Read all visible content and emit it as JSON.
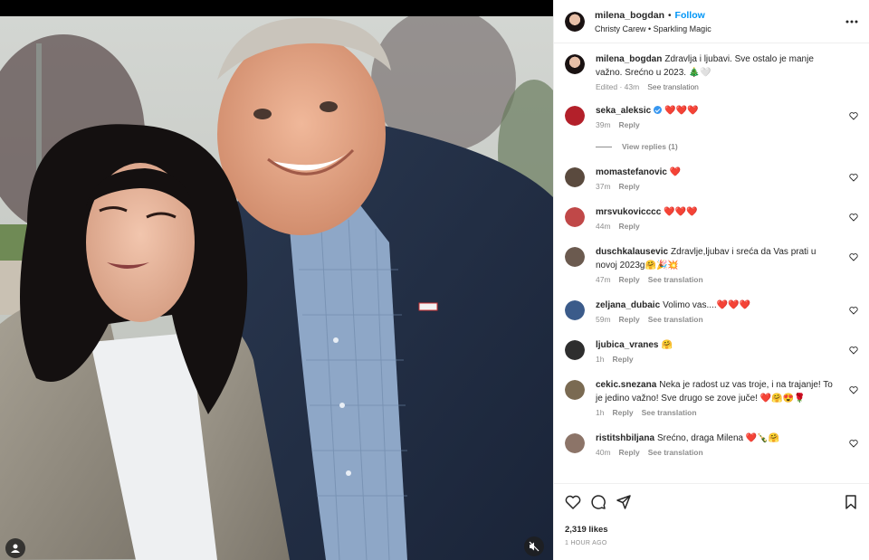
{
  "post": {
    "username": "milena_bogdan",
    "follow_label": "Follow",
    "audio": "Christy Carew • Sparkling Magic",
    "caption": {
      "username": "milena_bogdan",
      "text": "Zdravlja i ljubavi. Sve ostalo je manje važno. Srećno u 2023. 🎄🤍",
      "time": "Edited · 43m",
      "see_translation": "See translation"
    }
  },
  "comments": [
    {
      "username": "seka_aleksic",
      "verified": true,
      "text": "❤️❤️❤️",
      "time": "39m",
      "reply": "Reply",
      "view_replies": "View replies (1)",
      "avatar_color": "#b3202a"
    },
    {
      "username": "momastefanovic",
      "text": "❤️",
      "time": "37m",
      "reply": "Reply",
      "avatar_color": "#5a4a3e"
    },
    {
      "username": "mrsvukovicccc",
      "text": "❤️❤️❤️",
      "time": "44m",
      "reply": "Reply",
      "avatar_color": "#c04848"
    },
    {
      "username": "duschkalausevic",
      "text": "Zdravlje,ljubav i sreća da Vas prati u novoj 2023g🤗🎉💥",
      "time": "47m",
      "reply": "Reply",
      "see_translation": "See translation",
      "avatar_color": "#6b5a4f"
    },
    {
      "username": "zeljana_dubaic",
      "text": "Volimo vas....❤️❤️❤️",
      "time": "59m",
      "reply": "Reply",
      "see_translation": "See translation",
      "avatar_color": "#3b5b8a"
    },
    {
      "username": "ljubica_vranes",
      "text": "🤗",
      "time": "1h",
      "reply": "Reply",
      "avatar_color": "#2e2e2e"
    },
    {
      "username": "cekic.snezana",
      "text": "Neka je radost uz vas troje, i na trajanje! To je jedino važno! Sve drugo se zove juče! ❤️🤗😍🌹",
      "time": "1h",
      "reply": "Reply",
      "see_translation": "See translation",
      "avatar_color": "#7a6a52"
    },
    {
      "username": "ristitshbiljana",
      "text": "Srećno, draga Milena ❤️🍾🤗",
      "time": "40m",
      "reply": "Reply",
      "see_translation": "See translation",
      "avatar_color": "#8c7468"
    }
  ],
  "footer": {
    "likes": "2,319 likes",
    "time_ago": "1 HOUR AGO"
  },
  "colors": {
    "accent": "#0095f6",
    "text": "#262626",
    "muted": "#8e8e8e",
    "border": "#efefef"
  }
}
